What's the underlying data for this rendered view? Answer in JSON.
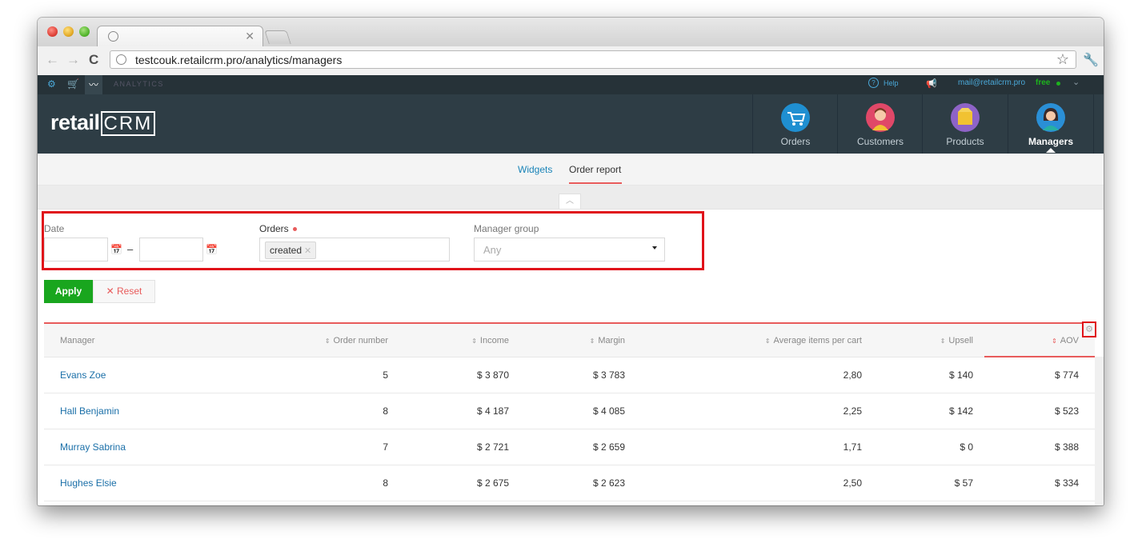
{
  "browser": {
    "url": "testcouk.retailcrm.pro/analytics/managers"
  },
  "appbar": {
    "section": "ANALYTICS",
    "help": "Help",
    "email": "mail@retailcrm.pro",
    "plan": "free"
  },
  "header": {
    "logo_retail": "retail",
    "logo_crm": "CRM",
    "nav": [
      {
        "label": "Orders",
        "icon": "orders-cart-icon",
        "color": "#1f8fd1"
      },
      {
        "label": "Customers",
        "icon": "customer-avatar-icon",
        "color": "#e04868"
      },
      {
        "label": "Products",
        "icon": "product-box-icon",
        "color": "#8e63c7"
      },
      {
        "label": "Managers",
        "icon": "manager-avatar-icon",
        "color": "#2a8fd6",
        "active": true
      }
    ]
  },
  "subnav": {
    "widgets": "Widgets",
    "order_report": "Order report"
  },
  "filters": {
    "date_label": "Date",
    "date_from": "",
    "date_to": "",
    "date_separator": "–",
    "orders_label": "Orders",
    "orders_chip": "created",
    "manager_group_label": "Manager group",
    "manager_group_value": "Any",
    "apply": "Apply",
    "reset": "Reset"
  },
  "table": {
    "columns": [
      "Manager",
      "Order number",
      "Income",
      "Margin",
      "Average items per cart",
      "Upsell",
      "AOV"
    ],
    "rows": [
      {
        "manager": "Evans Zoe",
        "orders": "5",
        "income": "$ 3 870",
        "margin": "$ 3 783",
        "avg_items": "2,80",
        "upsell": "$ 140",
        "aov": "$ 774"
      },
      {
        "manager": "Hall Benjamin",
        "orders": "8",
        "income": "$ 4 187",
        "margin": "$ 4 085",
        "avg_items": "2,25",
        "upsell": "$ 142",
        "aov": "$ 523"
      },
      {
        "manager": "Murray Sabrina",
        "orders": "7",
        "income": "$ 2 721",
        "margin": "$ 2 659",
        "avg_items": "1,71",
        "upsell": "$ 0",
        "aov": "$ 388"
      },
      {
        "manager": "Hughes Elsie",
        "orders": "8",
        "income": "$ 2 675",
        "margin": "$ 2 623",
        "avg_items": "2,50",
        "upsell": "$ 57",
        "aov": "$ 334"
      }
    ]
  },
  "colors": {
    "accent_red": "#e85b5b",
    "apply_green": "#19a61e",
    "link_blue": "#1a84b8",
    "header_bg": "#2e3d45"
  }
}
